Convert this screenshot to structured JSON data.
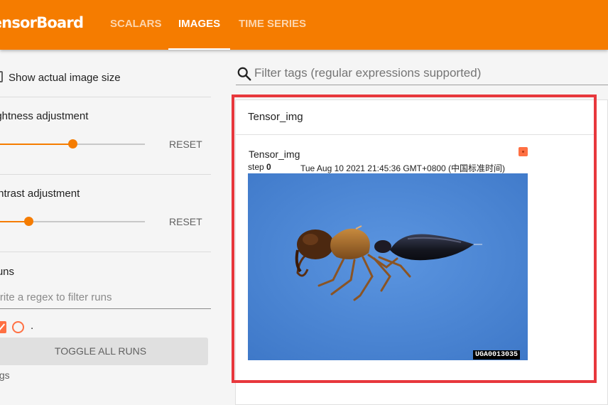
{
  "app": {
    "brand": "TensorBoard"
  },
  "nav": {
    "tabs": [
      {
        "label": "SCALARS"
      },
      {
        "label": "IMAGES"
      },
      {
        "label": "TIME SERIES"
      }
    ]
  },
  "sidebar": {
    "show_actual_size": "Show actual image size",
    "brightness": {
      "label": "Brightness adjustment",
      "reset": "RESET",
      "value": 0.5
    },
    "contrast": {
      "label": "Contrast adjustment",
      "reset": "RESET",
      "value": 0.2
    },
    "runs": {
      "title": "Runs",
      "filter_placeholder": "Write a regex to filter runs",
      "items": [
        {
          "name": "."
        }
      ],
      "toggle_all": "TOGGLE ALL RUNS",
      "logdir_label": "logs"
    }
  },
  "main": {
    "search_placeholder": "Filter tags (regular expressions supported)",
    "group": {
      "title": "Tensor_img",
      "card": {
        "tag": "Tensor_img",
        "step_label": "step",
        "step_value": "0",
        "timestamp": "Tue Aug 10 2021 21:45:36 GMT+0800 (中国标准时间)",
        "image_caption": "UGA0013035"
      }
    }
  },
  "colors": {
    "accent": "#f57c00",
    "run": "#ff7043",
    "highlight": "#e8383d",
    "photo_bg": "#4d86d6"
  }
}
